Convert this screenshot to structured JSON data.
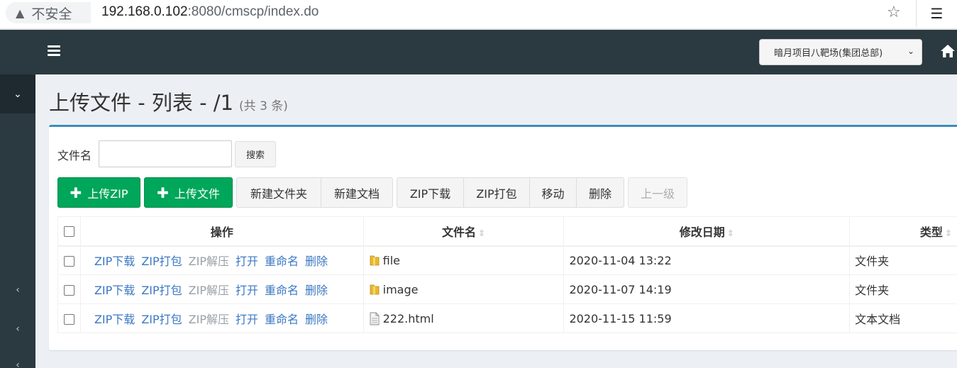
{
  "browser": {
    "security_label": "不安全",
    "url_host": "192.168.0.102",
    "url_rest": ":8080/cmscp/index.do"
  },
  "header": {
    "org_selected": "暗月项目八靶场(集团总部)"
  },
  "page": {
    "title": "上传文件 - 列表 - /1",
    "count_text": "(共 3 条)"
  },
  "search": {
    "label": "文件名",
    "value": "",
    "button": "搜索"
  },
  "toolbar": {
    "upload_zip": "上传ZIP",
    "upload_file": "上传文件",
    "new_folder": "新建文件夹",
    "new_doc": "新建文档",
    "zip_download": "ZIP下载",
    "zip_pack": "ZIP打包",
    "move": "移动",
    "delete": "删除",
    "parent": "上一级"
  },
  "table": {
    "columns": [
      "操作",
      "文件名",
      "修改日期",
      "类型"
    ],
    "row_actions": [
      "ZIP下载",
      "ZIP打包",
      "ZIP解压",
      "打开",
      "重命名",
      "删除"
    ],
    "rows": [
      {
        "name": "file",
        "date": "2020-11-04 13:22",
        "type": "文件夹",
        "icon": "folder-icon"
      },
      {
        "name": "image",
        "date": "2020-11-07 14:19",
        "type": "文件夹",
        "icon": "folder-icon"
      },
      {
        "name": "222.html",
        "date": "2020-11-15 11:59",
        "type": "文本文档",
        "icon": "document-icon"
      }
    ]
  }
}
